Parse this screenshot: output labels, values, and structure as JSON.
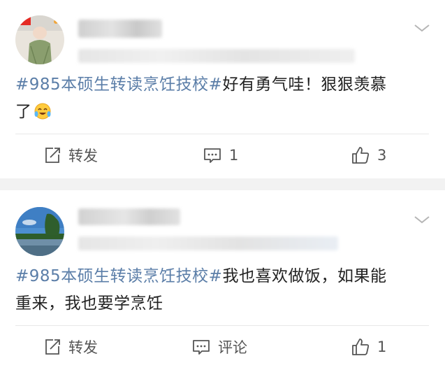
{
  "posts": [
    {
      "hashtag": "#985本硕生转读烹饪技校#",
      "text_line1": "好有勇气哇！狠狠羡慕",
      "text_line2": "了",
      "emoji": "crying-laughing-emoji",
      "actions": {
        "repost": "转发",
        "comment": "1",
        "like": "3"
      }
    },
    {
      "hashtag": "#985本硕生转读烹饪技校#",
      "text_line1": "我也喜欢做饭，如果能",
      "text_line2": "重来，我也要学烹饪",
      "actions": {
        "repost": "转发",
        "comment": "评论",
        "like": "1"
      }
    }
  ],
  "icons": {
    "repost": "repost-icon",
    "comment": "comment-icon",
    "like": "thumbs-up-icon",
    "menu": "chevron-down-icon"
  },
  "colors": {
    "hashtag": "#5b7ea8",
    "separator": "#f2f2f2"
  }
}
